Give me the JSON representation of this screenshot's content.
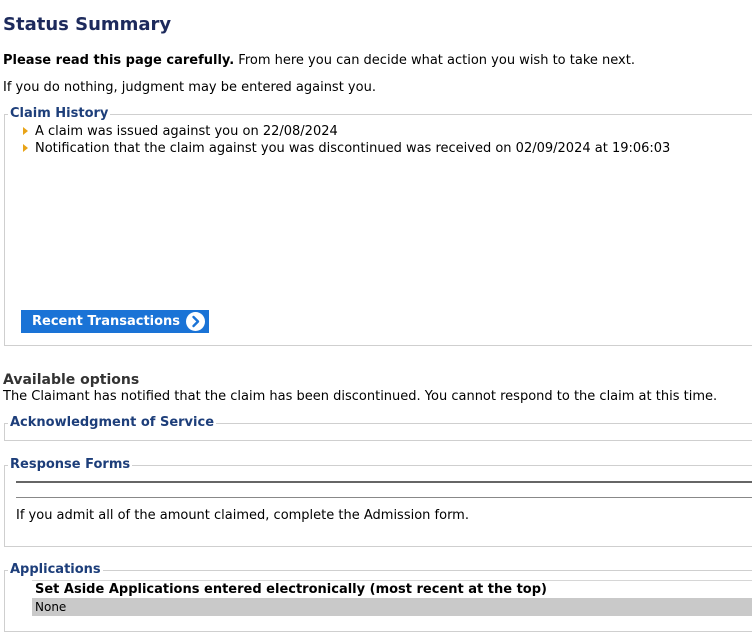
{
  "page": {
    "title": "Status Summary",
    "intro_bold": "Please read this page carefully.",
    "intro_rest": " From here you can decide what action you wish to take next.",
    "warning": "If you do nothing, judgment may be entered against you."
  },
  "claim_history": {
    "legend": "Claim History",
    "items": [
      "A claim was issued against you on 22/08/2024",
      "Notification that the claim against you was discontinued was received on 02/09/2024 at 19:06:03"
    ],
    "button_label": "Recent Transactions"
  },
  "options": {
    "heading": "Available options",
    "message": "The Claimant has notified that the claim has been discontinued. You cannot respond to the claim at this time."
  },
  "acknowledgment": {
    "legend": "Acknowledgment of Service"
  },
  "response_forms": {
    "legend": "Response Forms",
    "text": "If you admit all of the amount claimed, complete the Admission form."
  },
  "applications": {
    "legend": "Applications",
    "table_header": "Set Aside Applications entered electronically (most recent at the top)",
    "rows": [
      "None"
    ]
  },
  "colors": {
    "title": "#1d2a5c",
    "legend": "#1d3e7a",
    "button": "#1a73d6",
    "bullet": "#e8a317",
    "row_bg": "#c9c9c9"
  },
  "icons": {
    "bullet": "triangle-right-icon",
    "button": "chevron-right-circle-icon"
  }
}
